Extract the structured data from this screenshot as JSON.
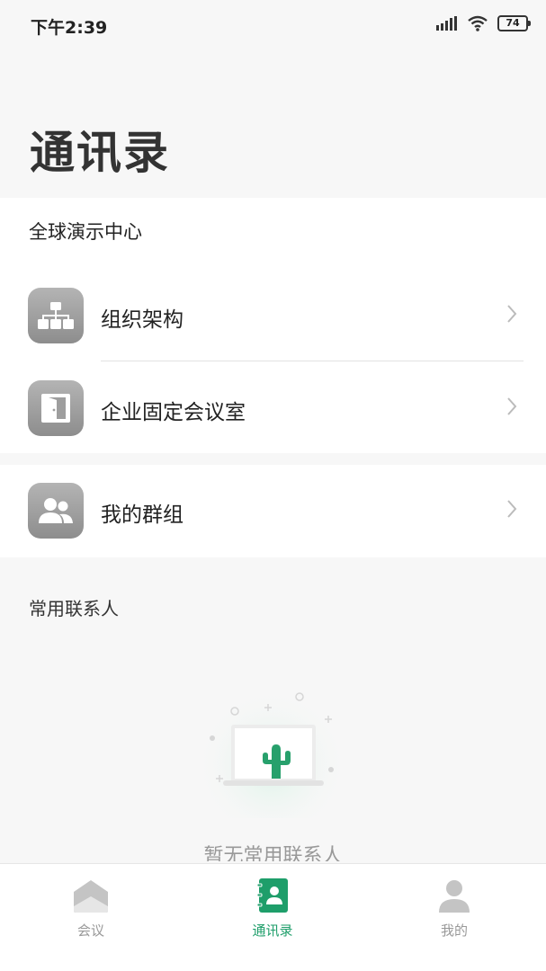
{
  "status_bar": {
    "time": "下午2:39",
    "battery": "74",
    "icons": [
      "signal-icon",
      "wifi-icon",
      "battery-icon"
    ]
  },
  "page_title": "通讯录",
  "organization": {
    "name": "全球演示中心",
    "items": [
      {
        "label": "组织架构",
        "icon": "org-chart-icon"
      },
      {
        "label": "企业固定会议室",
        "icon": "door-icon"
      }
    ]
  },
  "groups": {
    "label": "我的群组",
    "icon": "group-icon"
  },
  "frequent_contacts": {
    "title": "常用联系人",
    "empty_text": "暂无常用联系人"
  },
  "tab_bar": {
    "tabs": [
      {
        "label": "会议",
        "icon": "meeting-icon",
        "active": false
      },
      {
        "label": "通讯录",
        "icon": "contacts-icon",
        "active": true
      },
      {
        "label": "我的",
        "icon": "profile-icon",
        "active": false
      }
    ]
  },
  "colors": {
    "accent": "#1e9e6a",
    "icon_gray": "#9a9a9a",
    "background": "#f7f7f7"
  }
}
